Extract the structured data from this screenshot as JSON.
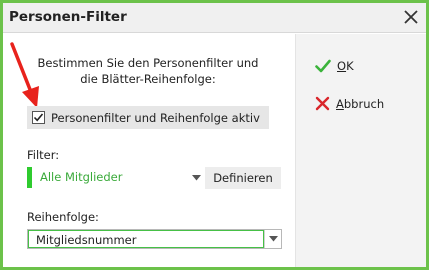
{
  "window": {
    "title": "Personen-Filter",
    "accent_color": "#6cc24a"
  },
  "main": {
    "instruction_line1": "Bestimmen Sie den Personenfilter und",
    "instruction_line2": "die Blätter-Reihenfolge:",
    "checkbox": {
      "label": "Personenfilter und Reihenfolge aktiv",
      "checked": true
    },
    "filter": {
      "label": "Filter:",
      "value": "Alle Mitglieder",
      "value_color": "#3aaa3a",
      "define_label": "Definieren"
    },
    "order": {
      "label": "Reihenfolge:",
      "value": "Mitgliedsnummer"
    }
  },
  "actions": {
    "ok": {
      "mnemonic": "O",
      "rest": "K",
      "icon": "checkmark-icon",
      "color": "#3bb33b"
    },
    "cancel": {
      "mnemonic": "A",
      "rest": "bbruch",
      "icon": "cross-icon",
      "color": "#d9262b"
    }
  },
  "annotation": {
    "icon": "red-arrow-icon",
    "color": "#e8221c"
  }
}
